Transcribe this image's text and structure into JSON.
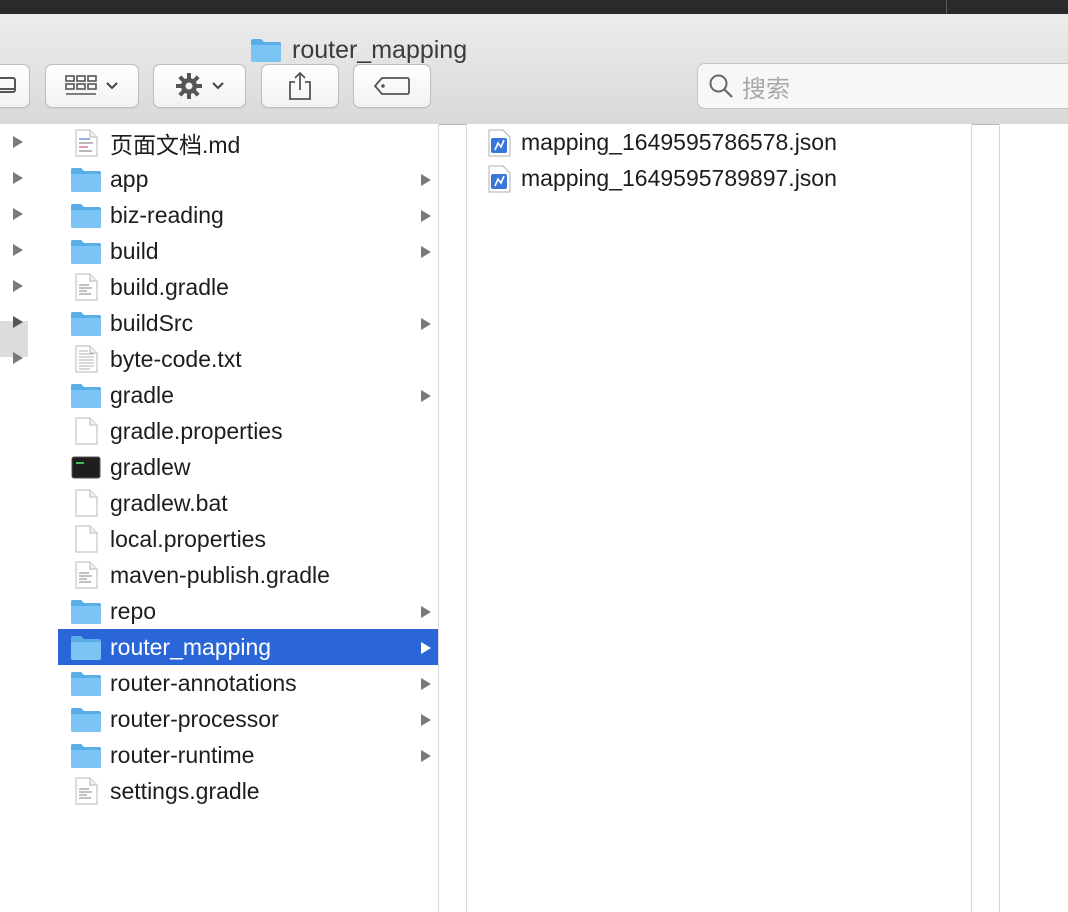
{
  "window": {
    "title": "router_mapping"
  },
  "toolbar": {
    "search_placeholder": "搜索"
  },
  "sidebar_column": {
    "arrow_count": 7
  },
  "files": [
    {
      "name": "页面文档.md",
      "type": "doc-md",
      "folder": false
    },
    {
      "name": "app",
      "type": "folder",
      "folder": true
    },
    {
      "name": "biz-reading",
      "type": "folder",
      "folder": true
    },
    {
      "name": "build",
      "type": "folder",
      "folder": true
    },
    {
      "name": "build.gradle",
      "type": "doc-lines",
      "folder": false
    },
    {
      "name": "buildSrc",
      "type": "folder",
      "folder": true
    },
    {
      "name": "byte-code.txt",
      "type": "doc-text",
      "folder": false
    },
    {
      "name": "gradle",
      "type": "folder",
      "folder": true
    },
    {
      "name": "gradle.properties",
      "type": "doc-blank",
      "folder": false
    },
    {
      "name": "gradlew",
      "type": "terminal",
      "folder": false
    },
    {
      "name": "gradlew.bat",
      "type": "doc-blank",
      "folder": false
    },
    {
      "name": "local.properties",
      "type": "doc-blank",
      "folder": false
    },
    {
      "name": "maven-publish.gradle",
      "type": "doc-lines",
      "folder": false
    },
    {
      "name": "repo",
      "type": "folder",
      "folder": true
    },
    {
      "name": "router_mapping",
      "type": "folder",
      "folder": true,
      "selected": true
    },
    {
      "name": "router-annotations",
      "type": "folder",
      "folder": true
    },
    {
      "name": "router-processor",
      "type": "folder",
      "folder": true
    },
    {
      "name": "router-runtime",
      "type": "folder",
      "folder": true
    },
    {
      "name": "settings.gradle",
      "type": "doc-lines",
      "folder": false
    }
  ],
  "preview_files": [
    {
      "name": "mapping_1649595786578.json",
      "type": "json"
    },
    {
      "name": "mapping_1649595789897.json",
      "type": "json"
    }
  ],
  "colors": {
    "selection": "#2b66d9",
    "folder": "#7cc4f4",
    "folder_dark": "#5aaee8"
  }
}
